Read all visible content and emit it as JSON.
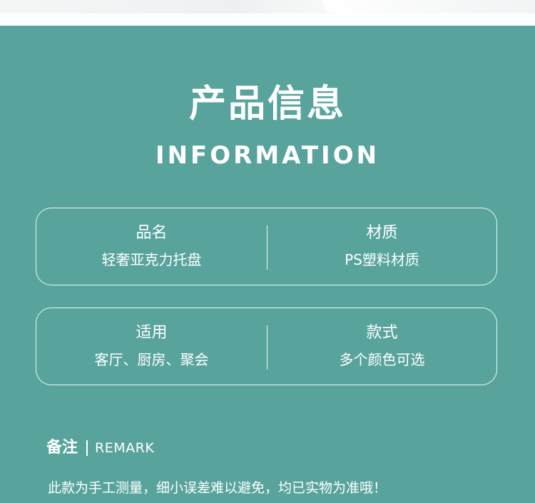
{
  "header": {
    "title_cn": "产品信息",
    "title_en": "INFORMATION"
  },
  "cards": [
    {
      "left": {
        "label": "品名",
        "value": "轻奢亚克力托盘"
      },
      "right": {
        "label": "材质",
        "value": "PS塑料材质"
      }
    },
    {
      "left": {
        "label": "适用",
        "value": "客厅、厨房、聚会"
      },
      "right": {
        "label": "款式",
        "value": "多个颜色可选"
      }
    }
  ],
  "remark": {
    "label": "备注",
    "label_en": "REMARK",
    "note": "此款为手工测量，细小误差难以避免，均已实物为准哦！"
  },
  "colors": {
    "background": "#58a49d",
    "text": "#ffffff"
  }
}
